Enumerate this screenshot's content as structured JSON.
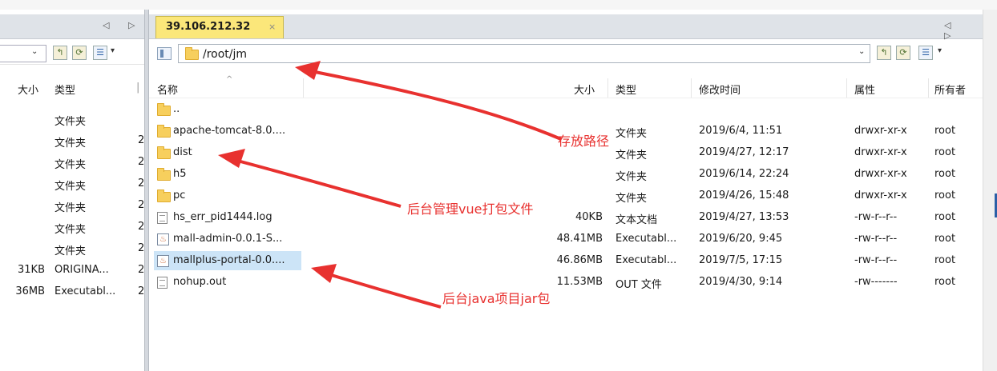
{
  "window": {
    "top_crumbs": [
      "",
      ""
    ],
    "colors": {
      "tab_active": "#fbe77a",
      "annotation": "#e8312f",
      "selection": "#cce4f7"
    }
  },
  "left_pane": {
    "nav_arrows": "◁ ▷",
    "headers": {
      "size": "大小",
      "type": "类型"
    },
    "rows": [
      {
        "size": "",
        "type": "文件夹",
        "trunc": ""
      },
      {
        "size": "",
        "type": "文件夹",
        "trunc": "2"
      },
      {
        "size": "",
        "type": "文件夹",
        "trunc": "2"
      },
      {
        "size": "",
        "type": "文件夹",
        "trunc": "2"
      },
      {
        "size": "",
        "type": "文件夹",
        "trunc": "2"
      },
      {
        "size": "",
        "type": "文件夹",
        "trunc": "2"
      },
      {
        "size": "",
        "type": "文件夹",
        "trunc": "2"
      },
      {
        "size": "31KB",
        "type": "ORIGINA...",
        "trunc": "2"
      },
      {
        "size": "36MB",
        "type": "Executabl...",
        "trunc": "2"
      }
    ]
  },
  "right_pane": {
    "tab": {
      "label": "39.106.212.32",
      "close": "×"
    },
    "nav_arrows": "◁ ▷",
    "path": "/root/jm",
    "headers": {
      "name": "名称",
      "size": "大小",
      "type": "类型",
      "modified": "修改时间",
      "attrs": "属性",
      "owner": "所有者"
    },
    "files": [
      {
        "icon": "folder-icon",
        "name": "..",
        "size": "",
        "type": "",
        "modified": "",
        "attrs": "",
        "owner": ""
      },
      {
        "icon": "folder-icon",
        "name": "apache-tomcat-8.0....",
        "size": "",
        "type": "文件夹",
        "modified": "2019/6/4, 11:51",
        "attrs": "drwxr-xr-x",
        "owner": "root"
      },
      {
        "icon": "folder-icon",
        "name": "dist",
        "size": "",
        "type": "文件夹",
        "modified": "2019/4/27, 12:17",
        "attrs": "drwxr-xr-x",
        "owner": "root"
      },
      {
        "icon": "folder-icon",
        "name": "h5",
        "size": "",
        "type": "文件夹",
        "modified": "2019/6/14, 22:24",
        "attrs": "drwxr-xr-x",
        "owner": "root"
      },
      {
        "icon": "folder-icon",
        "name": "pc",
        "size": "",
        "type": "文件夹",
        "modified": "2019/4/26, 15:48",
        "attrs": "drwxr-xr-x",
        "owner": "root"
      },
      {
        "icon": "text-file-icon",
        "name": "hs_err_pid1444.log",
        "size": "40KB",
        "type": "文本文档",
        "modified": "2019/4/27, 13:53",
        "attrs": "-rw-r--r--",
        "owner": "root"
      },
      {
        "icon": "java-jar-icon",
        "name": "mall-admin-0.0.1-S...",
        "size": "48.41MB",
        "type": "Executabl...",
        "modified": "2019/6/20, 9:45",
        "attrs": "-rw-r--r--",
        "owner": "root"
      },
      {
        "icon": "java-jar-icon",
        "name": "mallplus-portal-0.0....",
        "size": "46.86MB",
        "type": "Executabl...",
        "modified": "2019/7/5, 17:15",
        "attrs": "-rw-r--r--",
        "owner": "root"
      },
      {
        "icon": "text-file-icon",
        "name": "nohup.out",
        "size": "11.53MB",
        "type": "OUT 文件",
        "modified": "2019/4/30, 9:14",
        "attrs": "-rw-------",
        "owner": "root"
      }
    ]
  },
  "annotations": {
    "path_note": "存放路径",
    "vue_note": "后台管理vue打包文件",
    "jar_note": "后台java项目jar包"
  }
}
